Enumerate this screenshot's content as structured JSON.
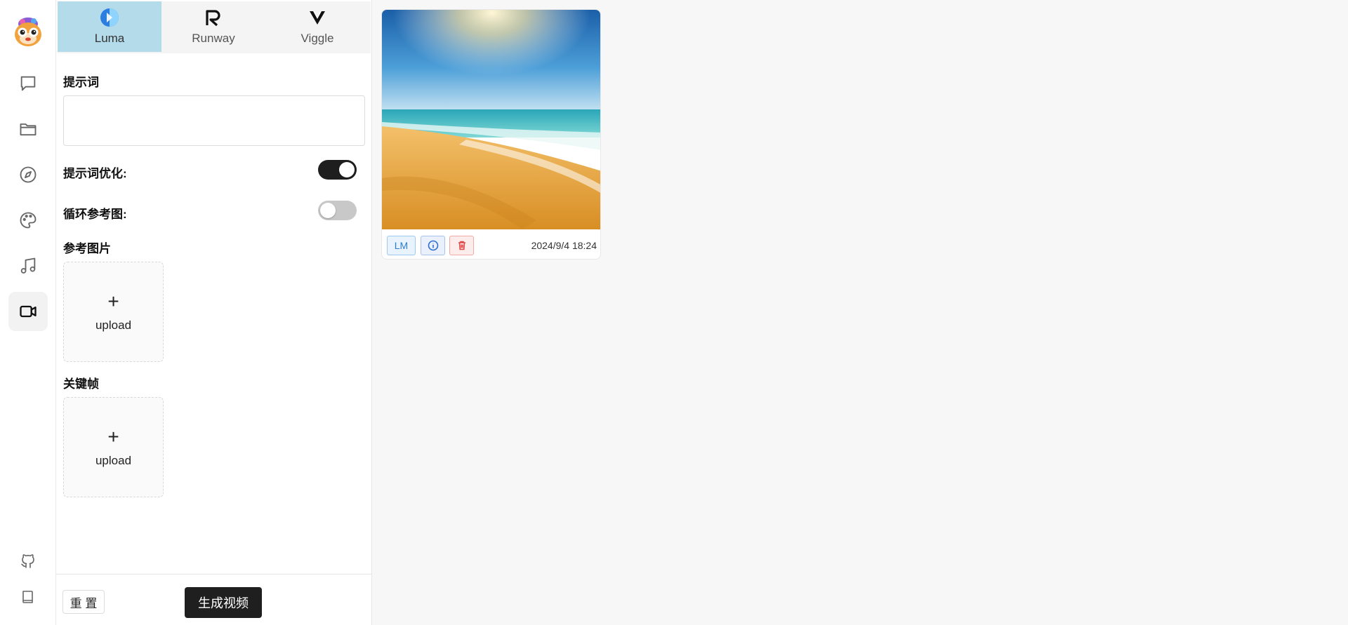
{
  "rail": {
    "items": [
      {
        "name": "chat",
        "icon": "chat-bubble-icon"
      },
      {
        "name": "files",
        "icon": "folder-icon"
      },
      {
        "name": "discover",
        "icon": "compass-icon"
      },
      {
        "name": "draw",
        "icon": "palette-icon"
      },
      {
        "name": "music",
        "icon": "music-note-icon"
      },
      {
        "name": "video",
        "icon": "video-camera-icon",
        "active": true
      }
    ],
    "bottom": [
      {
        "name": "github",
        "icon": "github-icon"
      },
      {
        "name": "docs",
        "icon": "book-icon"
      }
    ]
  },
  "tabs": [
    {
      "label": "Luma",
      "active": true
    },
    {
      "label": "Runway",
      "active": false
    },
    {
      "label": "Viggle",
      "active": false
    }
  ],
  "form": {
    "prompt_label": "提示词",
    "prompt_value": "",
    "optimize_label": "提示词优化:",
    "optimize_on": true,
    "loop_label": "循环参考图:",
    "loop_on": false,
    "ref_image_label": "参考图片",
    "keyframe_label": "关键帧",
    "upload_plus": "+",
    "upload_text": "upload"
  },
  "footer": {
    "reset_label": "重 置",
    "generate_label": "生成视频"
  },
  "result": {
    "tag": "LM",
    "timestamp": "2024/9/4 18:24"
  },
  "colors": {
    "active_tab": "#b3dbea",
    "primary_button": "#1f1f1f",
    "tag_blue": "#2f7ccc",
    "tag_red": "#e04848"
  }
}
